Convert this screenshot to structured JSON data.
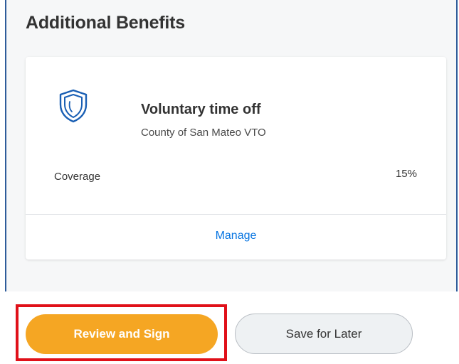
{
  "section": {
    "title": "Additional Benefits"
  },
  "benefit_card": {
    "icon": "shield-icon",
    "title": "Voluntary time off",
    "subtitle": "County of San Mateo VTO",
    "coverage_label": "Coverage",
    "coverage_value": "15%",
    "manage_label": "Manage"
  },
  "actions": {
    "primary_label": "Review and Sign",
    "secondary_label": "Save for Later"
  },
  "colors": {
    "primary_button": "#f5a623",
    "link": "#0875e1",
    "highlight": "#e01019",
    "shield": "#1a5fb4"
  }
}
